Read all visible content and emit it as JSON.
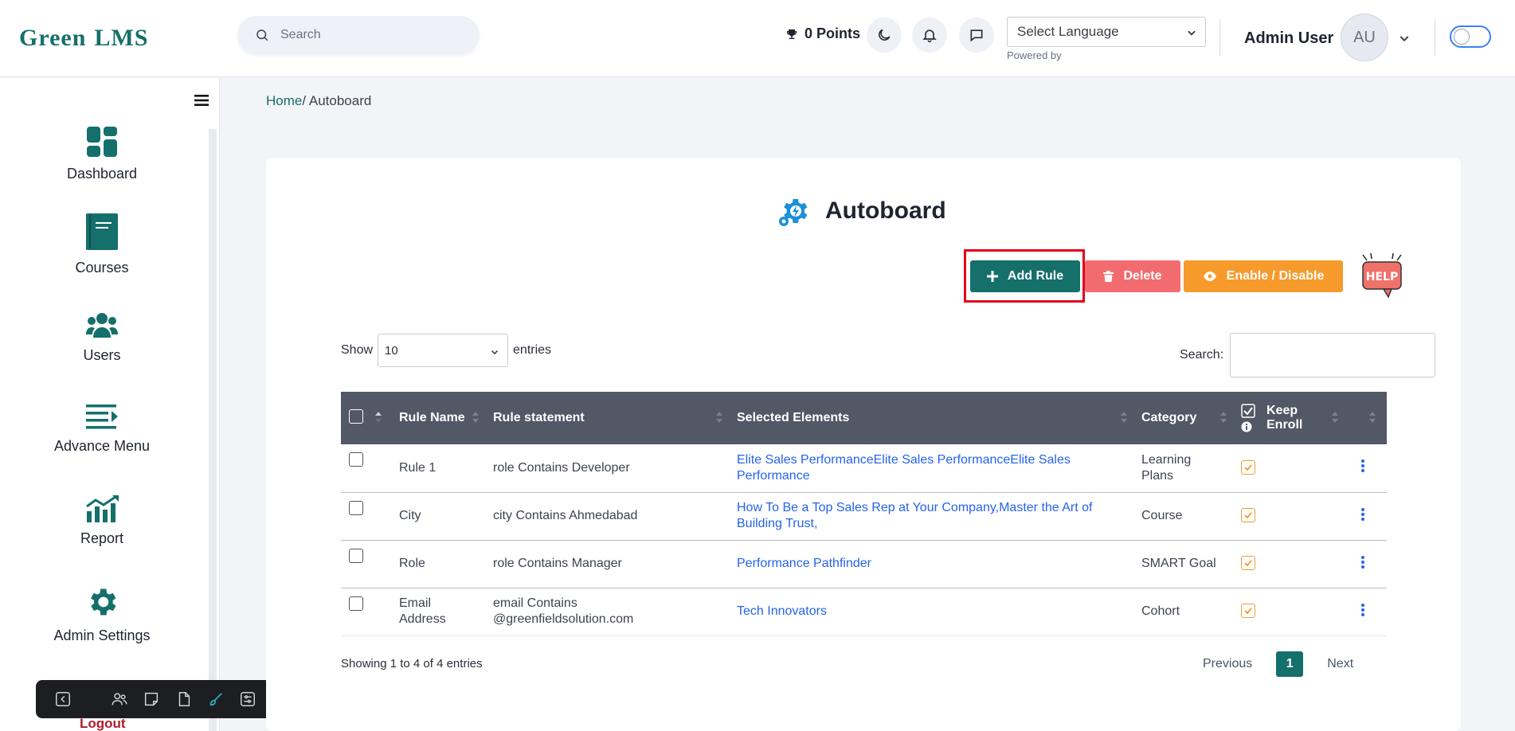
{
  "header": {
    "logo_text_1": "Green",
    "logo_text_2": "LMS",
    "search_placeholder": "Search",
    "points": "0 Points",
    "language_select": "Select Language",
    "powered_by": "Powered by",
    "admin_name": "Admin User",
    "avatar_initials": "AU"
  },
  "sidebar": {
    "items": [
      {
        "label": "Dashboard",
        "icon": "dashboard-icon"
      },
      {
        "label": "Courses",
        "icon": "book-icon"
      },
      {
        "label": "Users",
        "icon": "users-icon"
      },
      {
        "label": "Advance Menu",
        "icon": "menu-list-icon"
      },
      {
        "label": "Report",
        "icon": "chart-icon"
      },
      {
        "label": "Admin Settings",
        "icon": "gear-icon"
      }
    ],
    "logout": "Logout"
  },
  "breadcrumb": {
    "home": "Home",
    "current": "Autoboard"
  },
  "page": {
    "title": "Autoboard",
    "add_rule": "Add Rule",
    "delete": "Delete",
    "enable_disable": "Enable / Disable",
    "help": "HELP"
  },
  "table_controls": {
    "show_label": "Show",
    "entries_value": "10",
    "entries_label": "entries",
    "search_label": "Search:"
  },
  "table": {
    "headers": [
      "Rule Name",
      "Rule statement",
      "Selected Elements",
      "Category",
      "Keep Enroll"
    ],
    "rows": [
      {
        "name": "Rule 1",
        "statement": "role Contains Developer",
        "elements": "Elite Sales PerformanceElite Sales PerformanceElite Sales Performance",
        "category": "Learning Plans"
      },
      {
        "name": "City",
        "statement": "city Contains Ahmedabad",
        "elements": "How To Be a Top Sales Rep at Your Company,Master the Art of Building Trust,",
        "category": "Course"
      },
      {
        "name": "Role",
        "statement": "role Contains Manager",
        "elements": "Performance Pathfinder",
        "category": "SMART Goal"
      },
      {
        "name": "Email Address",
        "statement": "email Contains @greenfieldsolution.com",
        "elements": "Tech Innovators",
        "category": "Cohort"
      }
    ]
  },
  "footer": {
    "info": "Showing 1 to 4 of 4 entries",
    "previous": "Previous",
    "current_page": "1",
    "next": "Next"
  },
  "colors": {
    "brand": "#156f6b",
    "accent_red": "#b11a3b",
    "delete": "#f26c6f",
    "enable": "#f79a2c",
    "link": "#2563eb"
  }
}
